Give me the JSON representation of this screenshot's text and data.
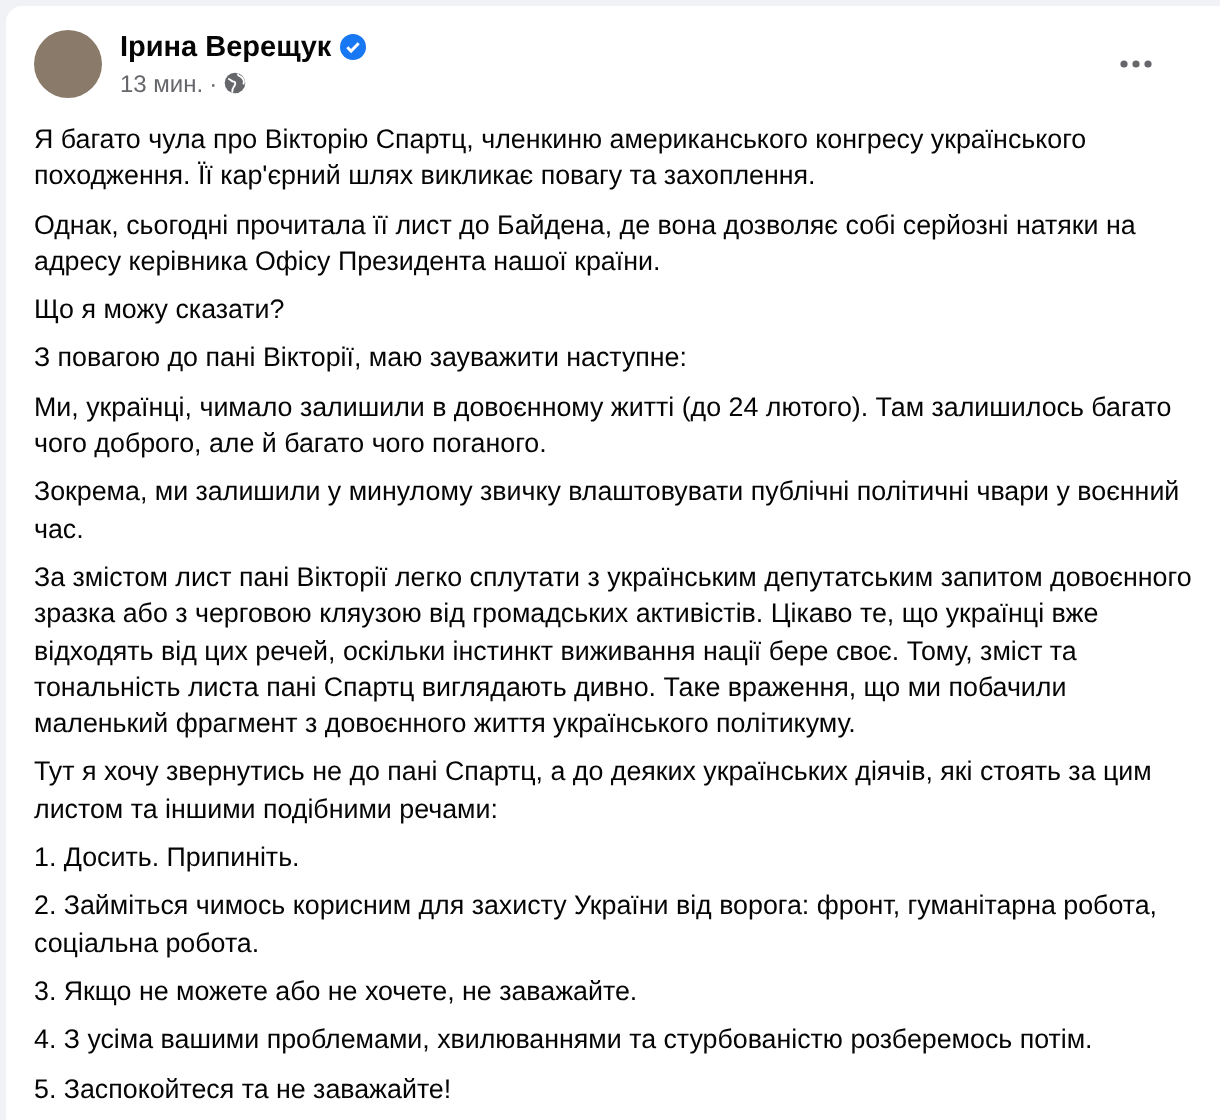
{
  "post": {
    "author": "Ірина Верещук",
    "verified": true,
    "time": "13 мин.",
    "separator": "·",
    "paragraphs": [
      "Я багато чула про Вікторію Спартц, членкиню американського конгресу українського походження. Її кар'єрний шлях викликає повагу та захоплення.",
      "Однак, сьогодні прочитала її лист до Байдена, де вона дозволяє собі серйозні натяки на адресу керівника Офісу Президента нашої країни.",
      "Що я можу сказати?",
      "З повагою до пані Вікторії, маю зауважити наступне:",
      "Ми, українці, чимало залишили в довоєнному житті (до 24 лютого). Там залишилось багато чого доброго, але й багато чого поганого.",
      "Зокрема, ми залишили у минулому звичку влаштовувати публічні політичні чвари у воєнний час.",
      "За змістом лист пані Вікторії легко сплутати з українським депутатським запитом довоєнного зразка або з черговою кляузою від громадських активістів. Цікаво те, що українці вже відходять від цих речей, оскільки інстинкт виживання нації бере своє. Тому, зміст та тональність листа пані Спартц виглядають дивно. Таке враження, що ми побачили маленький фрагмент з довоєнного життя українського політикуму.",
      "Тут я хочу звернутись не до пані Спартц, а до деяких українських діячів, які стоять за цим листом та іншими подібними речами:",
      "1. Досить. Припиніть.",
      "2. Займіться чимось корисним для захисту України від ворога: фронт, гуманітарна робота, соціальна робота.",
      "3. Якщо не можете або не хочете, не заважайте.",
      "4. З усіма вашими проблемами, хвилюваннями та стурбованістю розберемось потім.",
      "5. Заспокойтеся та не заважайте!"
    ]
  }
}
